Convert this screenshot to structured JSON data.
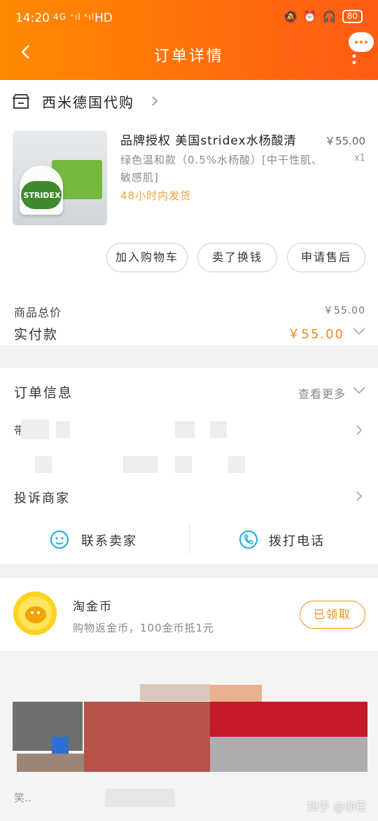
{
  "status_bar": {
    "time": "14:20",
    "network": "4G ⁺ıl ᴷıl",
    "hd": "HD",
    "battery": "80"
  },
  "header": {
    "title": "订单详情"
  },
  "shop": {
    "name": "西米德国代购"
  },
  "product": {
    "title": "品牌授权 美国stridex水杨酸清",
    "sku": "绿色温和款（0.5%水杨酸）[中干性肌、敏感肌]",
    "shipping": "48小时内发货",
    "price": "￥55.00",
    "qty": "x1",
    "image_text": "STRIDEX"
  },
  "actions": {
    "add_to_cart": "加入购物车",
    "sell_cash": "卖了换钱",
    "after_sale": "申请售后"
  },
  "summary": {
    "total_label": "商品总价",
    "total_value": "￥55.00",
    "paid_label": "实付款",
    "paid_value": "￥55.00"
  },
  "order_info": {
    "title": "订单信息",
    "more": "查看更多",
    "row1_partial": "带",
    "complain": "投诉商家"
  },
  "contact": {
    "seller": "联系卖家",
    "phone": "拨打电话"
  },
  "taojinbi": {
    "title": "淘金币",
    "desc": "购物返金币，100金币抵1元",
    "button": "已领取"
  },
  "watermark": "知乎 @亦臣",
  "bottom_partial": "笑..",
  "colors": {
    "header_start": "#ff8a00",
    "header_end": "#ff5a14",
    "accent": "#f08a24"
  }
}
